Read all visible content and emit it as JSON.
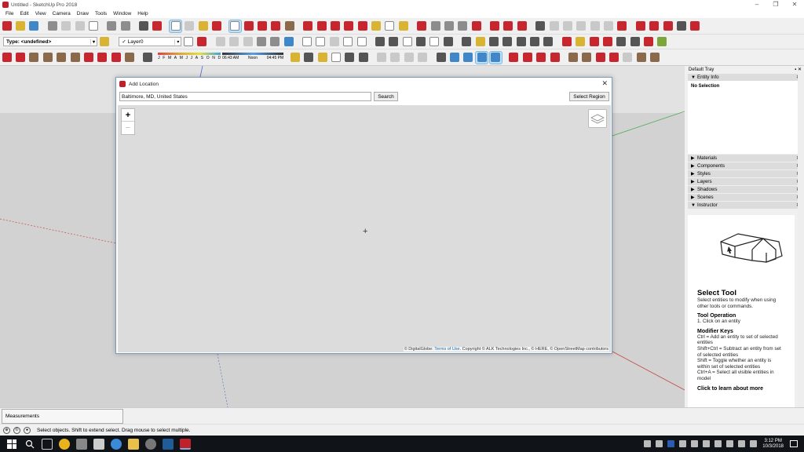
{
  "window": {
    "title": "Untitled - SketchUp Pro 2018",
    "controls": [
      "–",
      "❐",
      "✕"
    ]
  },
  "menu": [
    "File",
    "Edit",
    "View",
    "Camera",
    "Draw",
    "Tools",
    "Window",
    "Help"
  ],
  "toolbar": {
    "type_combo": "Type: <undefined>",
    "layer_combo": "Layer0",
    "months": [
      "J",
      "F",
      "M",
      "A",
      "M",
      "J",
      "J",
      "A",
      "S",
      "O",
      "N",
      "D"
    ],
    "time_start": "06:43 AM",
    "time_noon": "Noon",
    "time_end": "04:45 PM"
  },
  "dialog": {
    "title": "Add Location",
    "location_value": "Baltimore, MD, United States",
    "search_label": "Search",
    "select_region_label": "Select Region",
    "zoom_in": "+",
    "zoom_out": "−",
    "crosshair": "+",
    "attribution_prefix": "© DigitalGlobe:",
    "terms_link": "Terms of Use",
    "attribution_suffix": ". Copyright © ALK Technologies Inc., © HERE, © OpenStreetMap contributors"
  },
  "tray": {
    "title": "Default Tray",
    "entity_info": "Entity Info",
    "no_selection": "No Selection",
    "panels": [
      "Materials",
      "Components",
      "Styles",
      "Layers",
      "Shadows",
      "Scenes",
      "Instructor"
    ],
    "instructor": {
      "tool_title": "Select Tool",
      "tool_desc": "Select entities to modify when using other tools or commands.",
      "operation_head": "Tool Operation",
      "operation_text": "1. Click on an entity",
      "modifier_head": "Modifier Keys",
      "mod1": "Ctrl = Add an entity to set of selected entities",
      "mod2": "Shift+Ctrl = Subtract an entity from set of selected entities",
      "mod3": "Shift = Toggle whether an entity is within set of selected entities",
      "mod4": "Ctrl+A = Select all visible entities in model",
      "more": "Click to learn about more"
    }
  },
  "status": {
    "measurements_label": "Measurements",
    "hint": "Select objects. Shift to extend select. Drag mouse to select multiple."
  },
  "taskbar": {
    "time": "3:12 PM",
    "date": "10/3/2018"
  }
}
